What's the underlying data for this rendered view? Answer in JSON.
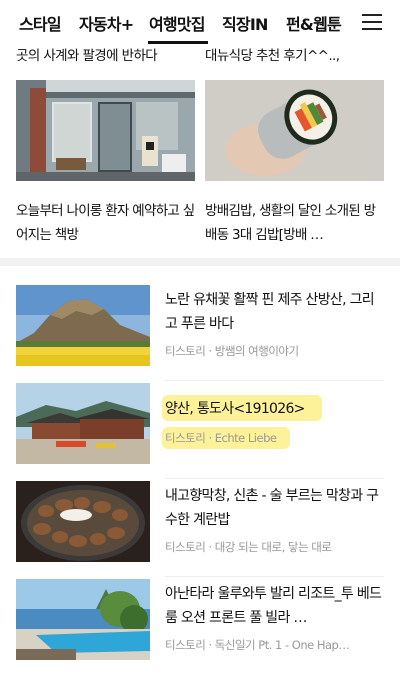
{
  "nav": {
    "tabs": [
      "스타일",
      "자동차+",
      "여행맛집",
      "직장IN",
      "펀&웹툰"
    ],
    "active_index": 2
  },
  "top_grid": {
    "cut_left": "곳의 사계와 팔경에 반하다",
    "cut_right": "대뉴식당 추천 후기^^..,",
    "left_caption": "오늘부터 나이롱 환자 예약하고 싶어지는 책방",
    "right_caption": "방배김밥, 생활의 달인 소개된 방배동 3대 김밥[방배 …"
  },
  "list": [
    {
      "title": "노란 유채꽃 활짝 핀 제주 산방산, 그리고 푸른 바다",
      "meta": "티스토리 · 방쌤의 여행이야기"
    },
    {
      "title": "양산, 통도사<191026>",
      "meta": "티스토리 · Echte Liebe"
    },
    {
      "title": "내고향막창, 신촌 - 술 부르는 막창과 구수한 계란밥",
      "meta": "티스토리 · 대강 되는 대로, 닿는 대로"
    },
    {
      "title": "아난타라 울루와투 발리 리조트_투 베드룸 오션 프론트 풀 빌라 …",
      "meta": "티스토리 · 독신일기 Pt. 1 - One Hap…"
    }
  ],
  "colors": {
    "highlight": "#fcec78",
    "meta_text": "#999999",
    "separator": "#f2f2f2"
  }
}
